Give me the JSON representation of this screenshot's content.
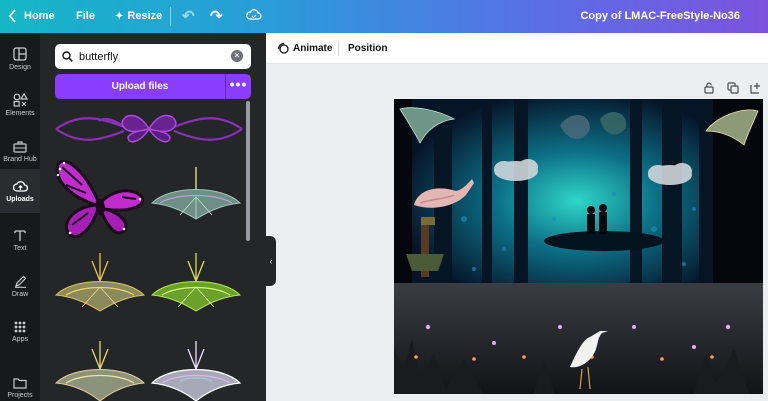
{
  "topbar": {
    "home": "Home",
    "file": "File",
    "resize": "Resize",
    "title": "Copy of LMAC-FreeStyle-No36"
  },
  "rail": [
    {
      "label": "Design",
      "icon": "design-icon"
    },
    {
      "label": "Elements",
      "icon": "elements-icon"
    },
    {
      "label": "Brand Hub",
      "icon": "brand-hub-icon"
    },
    {
      "label": "Uploads",
      "icon": "uploads-icon",
      "active": true
    },
    {
      "label": "Text",
      "icon": "text-icon"
    },
    {
      "label": "Draw",
      "icon": "draw-icon"
    },
    {
      "label": "Apps",
      "icon": "apps-icon"
    },
    {
      "label": "Projects",
      "icon": "projects-icon"
    }
  ],
  "panel": {
    "search_value": "butterfly",
    "upload_label": "Upload files",
    "more": "•••"
  },
  "ctxbar": {
    "animate": "Animate",
    "position": "Position"
  },
  "colors": {
    "accent": "#8b3dff",
    "rail_bg": "#18191b",
    "panel_bg": "#252627"
  }
}
